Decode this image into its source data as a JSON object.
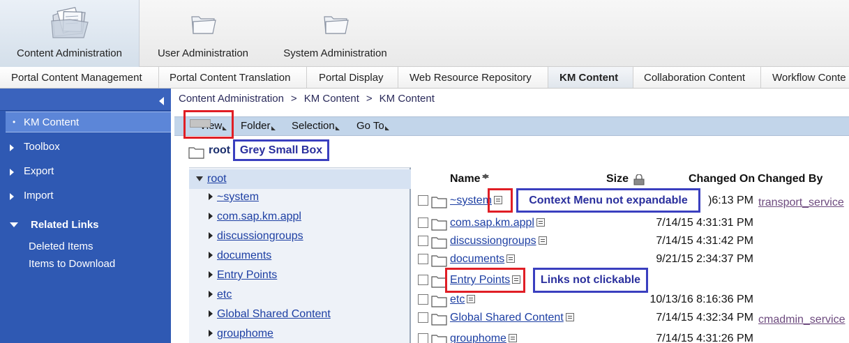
{
  "top_nav": [
    {
      "label": "Content Administration",
      "icon": "content-admin-icon",
      "active": true
    },
    {
      "label": "User Administration",
      "icon": "folder-icon",
      "active": false
    },
    {
      "label": "System Administration",
      "icon": "folder-icon",
      "active": false
    }
  ],
  "sub_nav": [
    {
      "label": "Portal Content Management"
    },
    {
      "label": "Portal Content Translation"
    },
    {
      "label": "Portal Display"
    },
    {
      "label": "Web Resource Repository"
    },
    {
      "label": "KM Content",
      "active": true
    },
    {
      "label": "Collaboration Content"
    },
    {
      "label": "Workflow Conte"
    }
  ],
  "left_panel": {
    "selected_item": "KM Content",
    "items": [
      "Toolbox",
      "Export",
      "Import"
    ],
    "related_links_title": "Related Links",
    "related_links": [
      "Deleted Items",
      "Items to Download"
    ]
  },
  "breadcrumb": [
    "Content Administration",
    "KM Content",
    "KM Content"
  ],
  "breadcrumb_separator": ">",
  "toolbar": {
    "view_label": "View",
    "folder_label": "Folder",
    "selection_label": "Selection",
    "goto_label": "Go To"
  },
  "root_label": "root",
  "tree": {
    "root": "root",
    "items": [
      "~system",
      "com.sap.km.appl",
      "discussiongroups",
      "documents",
      "Entry Points",
      "etc",
      "Global Shared Content",
      "grouphome"
    ]
  },
  "list": {
    "headers": {
      "name": "Name",
      "size": "Size",
      "changed_on": "Changed On",
      "changed_by": "Changed By"
    },
    "rows": [
      {
        "name": "~system",
        "changed_on": ")6:13 PM",
        "changed_by": "transport_service"
      },
      {
        "name": "com.sap.km.appl",
        "changed_on": "7/14/15 4:31:31 PM",
        "changed_by": ""
      },
      {
        "name": "discussiongroups",
        "changed_on": "7/14/15 4:31:42 PM",
        "changed_by": ""
      },
      {
        "name": "documents",
        "changed_on": "9/21/15 2:34:37 PM",
        "changed_by": ""
      },
      {
        "name": "Entry Points",
        "changed_on": "",
        "changed_by": ""
      },
      {
        "name": "etc",
        "changed_on": "10/13/16 8:16:36 PM",
        "changed_by": ""
      },
      {
        "name": "Global Shared Content",
        "changed_on": "7/14/15 4:32:34 PM",
        "changed_by": "cmadmin_service"
      },
      {
        "name": "grouphome",
        "changed_on": "7/14/15 4:31:26 PM",
        "changed_by": ""
      }
    ]
  },
  "annotations": {
    "grey_box": "Grey Small Box",
    "context_menu": "Context Menu not expandable",
    "links": "Links not clickable"
  },
  "colors": {
    "left_panel_bg": "#2f59b3",
    "toolbar_bg": "#c2d5ea",
    "link": "#1d3fa3",
    "annotation_red": "#e01e25",
    "annotation_blue": "#3a3fbf"
  }
}
